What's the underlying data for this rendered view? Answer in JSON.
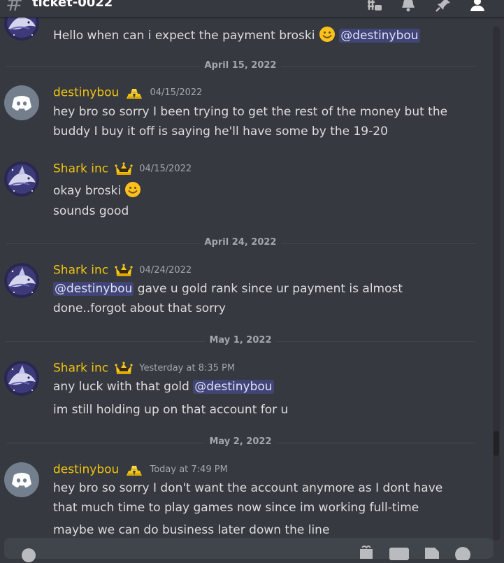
{
  "channel": {
    "name": "ticket-0022"
  },
  "messages": {
    "m0": {
      "text": "Hello when can i expect the payment broski",
      "mention": "@destinybou"
    },
    "d1": "April 15, 2022",
    "m1": {
      "author": "destinybou",
      "time": "04/15/2022",
      "line1": "hey bro so sorry I been trying to get the rest of the money but the",
      "line2": "buddy I buy it off is saying he'll have some by the 19-20"
    },
    "m2": {
      "author": "Shark inc",
      "time": "04/15/2022",
      "line1": "okay broski",
      "line2": "sounds good"
    },
    "d2": "April 24, 2022",
    "m3": {
      "author": "Shark inc",
      "time": "04/24/2022",
      "mention": "@destinybou",
      "line1": "gave u gold rank since ur payment is almost",
      "line2": "done..forgot about that sorry"
    },
    "d3": "May 1, 2022",
    "m4": {
      "author": "Shark inc",
      "time": "Yesterday at 8:35 PM",
      "line1": "any luck with that gold",
      "mention": "@destinybou",
      "line2": "im still holding up on that account for u"
    },
    "d4": "May 2, 2022",
    "m5": {
      "author": "destinybou",
      "time": "Today at 7:49 PM",
      "line1": "hey bro so sorry I don't want the account anymore as I dont have",
      "line2": "that much time to play games now since im working full-time",
      "line3": "maybe we can do business later down the line"
    }
  },
  "colors": {
    "background": "#36393f",
    "author": "#f1c40f",
    "mention_bg": "#4a5094",
    "mention_text": "#dee0fc"
  },
  "icons": [
    "hash-icon",
    "threads-icon",
    "bell-icon",
    "pin-icon",
    "members-icon",
    "emoji-icon",
    "discord-avatar",
    "shark-avatar",
    "crown-badge",
    "gold-bars-badge",
    "gift-icon",
    "gif-icon",
    "sticker-icon"
  ]
}
